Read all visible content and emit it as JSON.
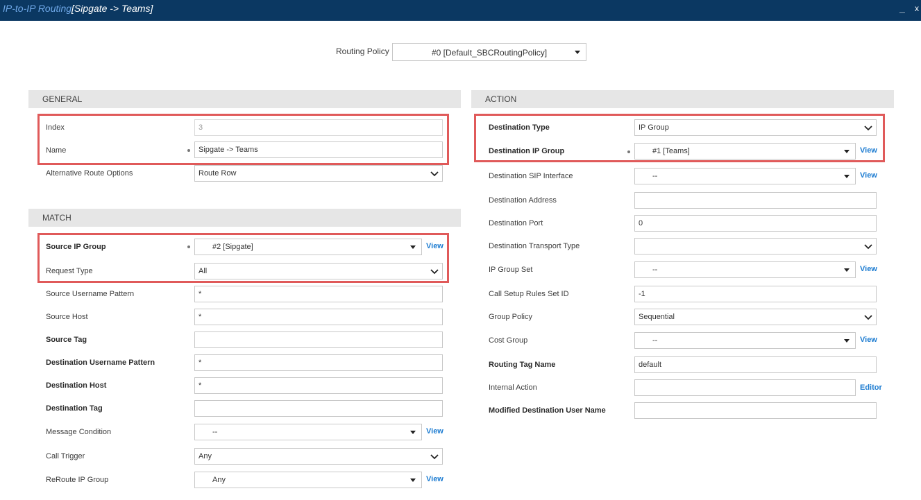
{
  "window": {
    "title_prefix": "IP-to-IP Routing",
    "title_item": "[Sipgate -> Teams]",
    "minimize_glyph": "_",
    "close_glyph": "x"
  },
  "routing_policy": {
    "label": "Routing Policy",
    "value": "#0 [Default_SBCRoutingPolicy]"
  },
  "general": {
    "header": "GENERAL",
    "index_label": "Index",
    "index_value": "3",
    "name_label": "Name",
    "name_value": "Sipgate -> Teams",
    "alt_route_label": "Alternative Route Options",
    "alt_route_value": "Route Row"
  },
  "match": {
    "header": "MATCH",
    "source_ip_group_label": "Source IP Group",
    "source_ip_group_value": "#2 [Sipgate]",
    "request_type_label": "Request Type",
    "request_type_value": "All",
    "source_username_label": "Source Username Pattern",
    "source_username_value": "*",
    "source_host_label": "Source Host",
    "source_host_value": "*",
    "source_tag_label": "Source Tag",
    "source_tag_value": "",
    "dest_username_label": "Destination Username Pattern",
    "dest_username_value": "*",
    "dest_host_label": "Destination Host",
    "dest_host_value": "*",
    "dest_tag_label": "Destination Tag",
    "dest_tag_value": "",
    "message_condition_label": "Message Condition",
    "message_condition_value": "--",
    "call_trigger_label": "Call Trigger",
    "call_trigger_value": "Any",
    "reroute_ip_group_label": "ReRoute IP Group",
    "reroute_ip_group_value": "Any"
  },
  "action": {
    "header": "ACTION",
    "dest_type_label": "Destination Type",
    "dest_type_value": "IP Group",
    "dest_ip_group_label": "Destination IP Group",
    "dest_ip_group_value": "#1 [Teams]",
    "dest_sip_interface_label": "Destination SIP Interface",
    "dest_sip_interface_value": "--",
    "dest_address_label": "Destination Address",
    "dest_address_value": "",
    "dest_port_label": "Destination Port",
    "dest_port_value": "0",
    "dest_transport_label": "Destination Transport Type",
    "dest_transport_value": "",
    "ip_group_set_label": "IP Group Set",
    "ip_group_set_value": "--",
    "call_setup_label": "Call Setup Rules Set ID",
    "call_setup_value": "-1",
    "group_policy_label": "Group Policy",
    "group_policy_value": "Sequential",
    "cost_group_label": "Cost Group",
    "cost_group_value": "--",
    "routing_tag_label": "Routing Tag Name",
    "routing_tag_value": "default",
    "internal_action_label": "Internal Action",
    "internal_action_value": "",
    "modified_dest_user_label": "Modified Destination User Name",
    "modified_dest_user_value": ""
  },
  "links": {
    "view": "View",
    "editor": "Editor"
  },
  "colors": {
    "titlebar": "#0b3862",
    "highlight_box": "#e05a5a",
    "link": "#1d7cd1",
    "section_header_bg": "#e6e6e6"
  }
}
